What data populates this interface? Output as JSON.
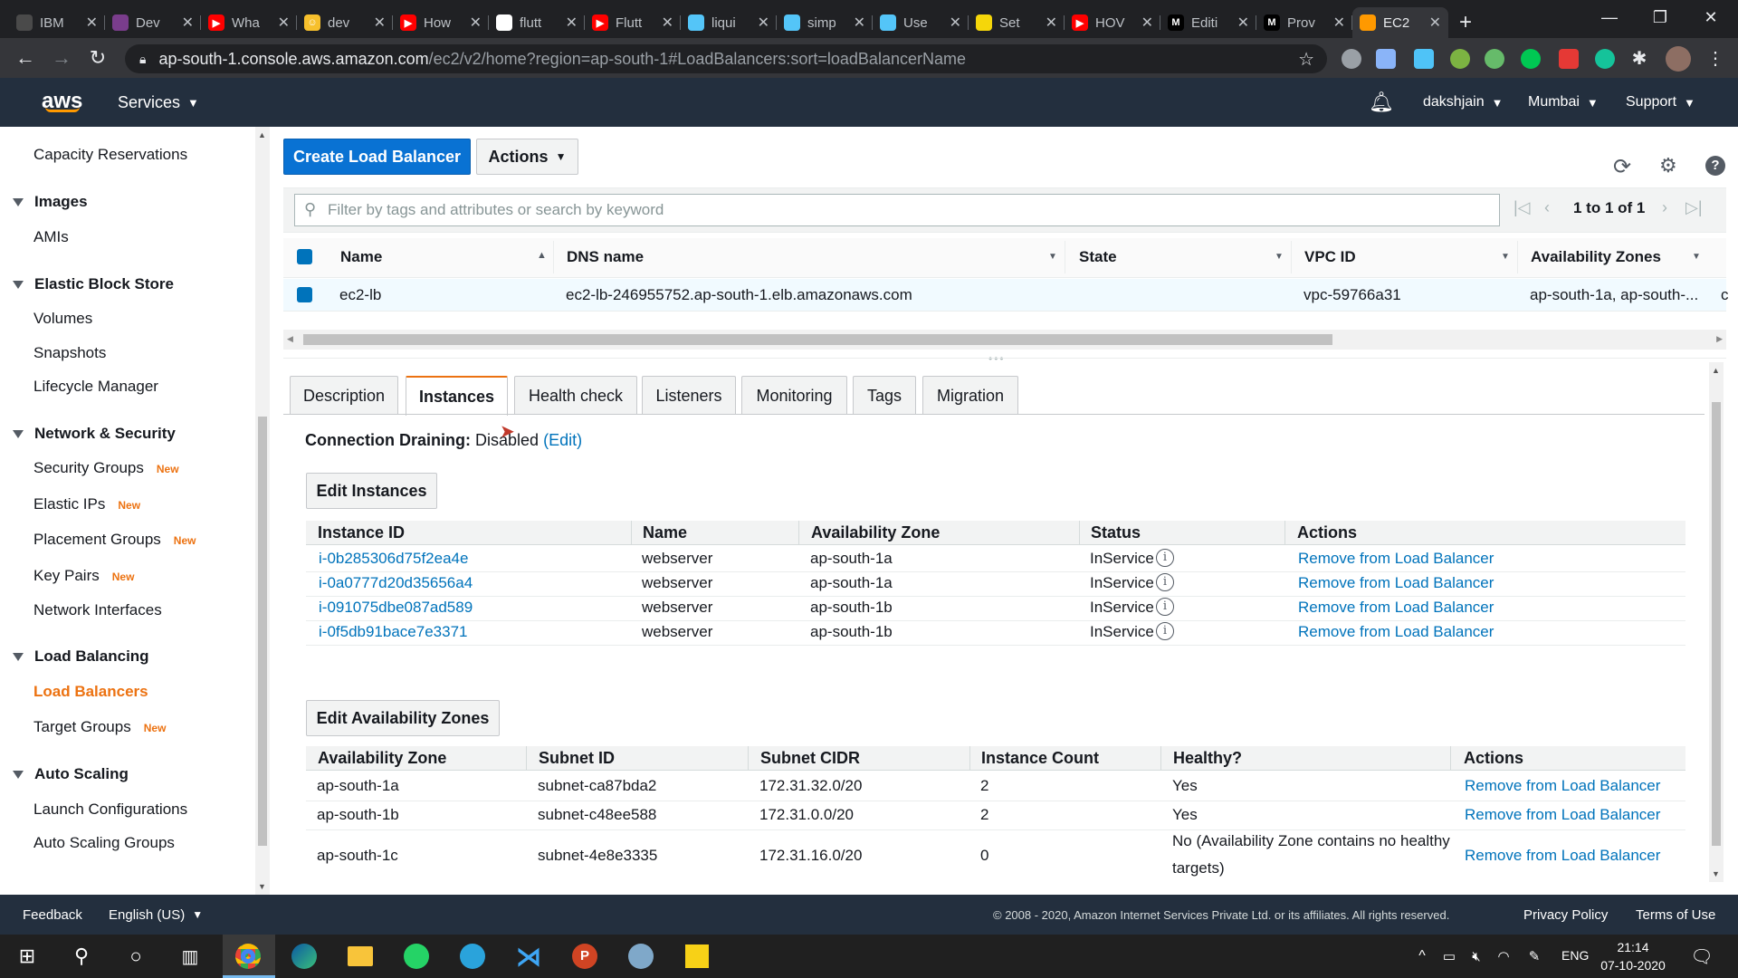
{
  "browser": {
    "tabs": [
      {
        "title": "IBM",
        "icon_color": "#4a4a4a",
        "icon_text": ""
      },
      {
        "title": "Dev",
        "icon_color": "#7a3d8c",
        "icon_text": ""
      },
      {
        "title": "Wha",
        "icon_color": "#ff0000",
        "icon_text": "▶"
      },
      {
        "title": "dev",
        "icon_color": "#f7c02c",
        "icon_text": "☺"
      },
      {
        "title": "How",
        "icon_color": "#ff0000",
        "icon_text": "▶"
      },
      {
        "title": "flutt",
        "icon_color": "#ffffff",
        "icon_text": ""
      },
      {
        "title": "Flutt",
        "icon_color": "#ff0000",
        "icon_text": "▶"
      },
      {
        "title": "liqui",
        "icon_color": "#54c5f8",
        "icon_text": ""
      },
      {
        "title": "simp",
        "icon_color": "#54c5f8",
        "icon_text": ""
      },
      {
        "title": "Use",
        "icon_color": "#54c5f8",
        "icon_text": ""
      },
      {
        "title": "Set",
        "icon_color": "#f5d60a",
        "icon_text": ""
      },
      {
        "title": "HOV",
        "icon_color": "#ff0000",
        "icon_text": "▶"
      },
      {
        "title": "Editi",
        "icon_color": "#000000",
        "icon_text": "M"
      },
      {
        "title": "Prov",
        "icon_color": "#000000",
        "icon_text": "M"
      },
      {
        "title": "EC2",
        "icon_color": "#f90",
        "icon_text": ""
      }
    ],
    "url_host": "ap-south-1.console.aws.amazon.com",
    "url_path": "/ec2/v2/home?region=ap-south-1#LoadBalancers:sort=loadBalancerName"
  },
  "awsnav": {
    "logo": "aws",
    "services": "Services",
    "user": "dakshjain",
    "region": "Mumbai",
    "support": "Support"
  },
  "sidebar": {
    "capacity": "Capacity Reservations",
    "images_head": "Images",
    "amis": "AMIs",
    "ebs_head": "Elastic Block Store",
    "volumes": "Volumes",
    "snapshots": "Snapshots",
    "lifecycle": "Lifecycle Manager",
    "netsec_head": "Network & Security",
    "secgroups": "Security Groups",
    "eips": "Elastic IPs",
    "placement": "Placement Groups",
    "keypairs": "Key Pairs",
    "netifaces": "Network Interfaces",
    "lb_head": "Load Balancing",
    "loadbalancers": "Load Balancers",
    "targetgroups": "Target Groups",
    "as_head": "Auto Scaling",
    "launchconfigs": "Launch Configurations",
    "asgroups": "Auto Scaling Groups",
    "new_badge": "New"
  },
  "toolbar": {
    "create_lb": "Create Load Balancer",
    "actions": "Actions",
    "filter_placeholder": "Filter by tags and attributes or search by keyword",
    "pagination": "1 to 1 of 1"
  },
  "lbgrid": {
    "headers": [
      "Name",
      "DNS name",
      "State",
      "VPC ID",
      "Availability Zones"
    ],
    "row": {
      "name": "ec2-lb",
      "dns": "ec2-lb-246955752.ap-south-1.elb.amazonaws.com",
      "state": "",
      "vpc": "vpc-59766a31",
      "azs": "ap-south-1a, ap-south-...",
      "overflow": "c"
    }
  },
  "detail_tabs": [
    "Description",
    "Instances",
    "Health check",
    "Listeners",
    "Monitoring",
    "Tags",
    "Migration"
  ],
  "instances": {
    "draining_label": "Connection Draining:",
    "draining_value": "Disabled",
    "edit_link": "(Edit)",
    "edit_instances": "Edit Instances",
    "headers": [
      "Instance ID",
      "Name",
      "Availability Zone",
      "Status",
      "Actions"
    ],
    "rows": [
      {
        "id": "i-0b285306d75f2ea4e",
        "name": "webserver",
        "az": "ap-south-1a",
        "status": "InService",
        "action": "Remove from Load Balancer"
      },
      {
        "id": "i-0a0777d20d35656a4",
        "name": "webserver",
        "az": "ap-south-1a",
        "status": "InService",
        "action": "Remove from Load Balancer"
      },
      {
        "id": "i-091075dbe087ad589",
        "name": "webserver",
        "az": "ap-south-1b",
        "status": "InService",
        "action": "Remove from Load Balancer"
      },
      {
        "id": "i-0f5db91bace7e3371",
        "name": "webserver",
        "az": "ap-south-1b",
        "status": "InService",
        "action": "Remove from Load Balancer"
      }
    ]
  },
  "zones": {
    "edit_zones": "Edit Availability Zones",
    "headers": [
      "Availability Zone",
      "Subnet ID",
      "Subnet CIDR",
      "Instance Count",
      "Healthy?",
      "Actions"
    ],
    "rows": [
      {
        "az": "ap-south-1a",
        "subnet": "subnet-ca87bda2",
        "cidr": "172.31.32.0/20",
        "count": "2",
        "healthy": "Yes",
        "healthy2": "",
        "action": "Remove from Load Balancer"
      },
      {
        "az": "ap-south-1b",
        "subnet": "subnet-c48ee588",
        "cidr": "172.31.0.0/20",
        "count": "2",
        "healthy": "Yes",
        "healthy2": "",
        "action": "Remove from Load Balancer"
      },
      {
        "az": "ap-south-1c",
        "subnet": "subnet-4e8e3335",
        "cidr": "172.31.16.0/20",
        "count": "0",
        "healthy": "No (Availability Zone contains no healthy",
        "healthy2": "targets)",
        "action": "Remove from Load Balancer"
      }
    ]
  },
  "footer": {
    "feedback": "Feedback",
    "language": "English (US)",
    "copyright": "© 2008 - 2020, Amazon Internet Services Private Ltd. or its affiliates. All rights reserved.",
    "privacy": "Privacy Policy",
    "terms": "Terms of Use"
  },
  "taskbar": {
    "lang": "ENG",
    "time": "21:14",
    "date": "07-10-2020"
  },
  "colors": {
    "aws_nav": "#232f3e",
    "accent_orange": "#ec7211",
    "link_blue": "#0073bb",
    "primary_button": "#0972d3"
  }
}
